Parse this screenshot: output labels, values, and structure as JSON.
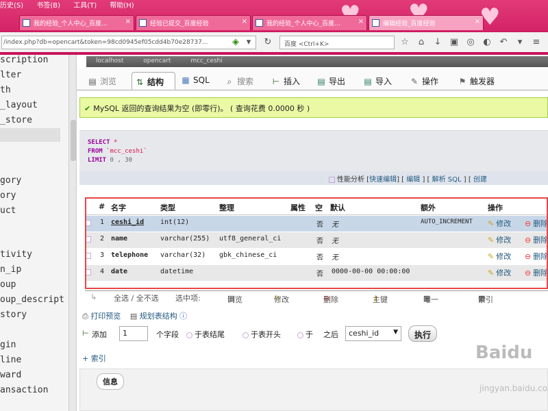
{
  "browser": {
    "menu": [
      "历史(S)",
      "书签(B)",
      "工具(T)",
      "帮助(H)"
    ],
    "tabs": [
      {
        "label": "我的经验_个人中心_百度..."
      },
      {
        "label": "经验已提交_百度经验"
      },
      {
        "label": "我的经验_个人中心_百度..."
      },
      {
        "label": "编辑经验_百度经验"
      }
    ],
    "url": "/index.php?db=opencart&token=98cd0945ef05cdd4b70e28737...",
    "search_placeholder": "百度 <Ctrl+K>"
  },
  "left_panel": {
    "items": [
      "scription",
      "lter",
      "th",
      "_layout",
      "_store",
      "gory",
      "ory",
      "uct",
      "tivity",
      "n_ip",
      "oup",
      "oup_descript",
      "story",
      "gin",
      "line",
      "ward",
      "ansaction"
    ]
  },
  "main": {
    "breadcrumb": [
      "localhost",
      "opencart",
      "mcc_ceshi"
    ],
    "tabs": [
      {
        "label": "浏览",
        "icon": "browse-icon"
      },
      {
        "label": "结构",
        "icon": "structure-icon"
      },
      {
        "label": "SQL",
        "icon": "sql-icon"
      },
      {
        "label": "搜索",
        "icon": "search-icon"
      },
      {
        "label": "插入",
        "icon": "insert-icon"
      },
      {
        "label": "导出",
        "icon": "export-icon"
      },
      {
        "label": "导入",
        "icon": "import-icon"
      },
      {
        "label": "操作",
        "icon": "operations-icon"
      },
      {
        "label": "触发器",
        "icon": "triggers-icon"
      }
    ],
    "success_message": "MySQL 返回的查询结果为空 (即零行)。 ( 查询花费 0.0000 秒 )",
    "sql": {
      "select": "SELECT",
      "select_arg": "*",
      "from": "FROM",
      "from_arg": "`mcc_ceshi`",
      "limit": "LIMIT",
      "limit_arg": "0 , 30"
    },
    "sql_links": {
      "profile": "性能分析",
      "inline_edit": "快速编辑",
      "edit": "编辑",
      "explain": "解析 SQL",
      "create": "创建"
    },
    "table": {
      "headers": [
        "#",
        "名字",
        "类型",
        "整理",
        "属性",
        "空",
        "默认",
        "额外",
        "操作"
      ],
      "rows": [
        {
          "num": "1",
          "name": "ceshi_id",
          "type": "int(12)",
          "collation": "",
          "null": "否",
          "default": "无",
          "extra": "AUTO_INCREMENT",
          "edit": "修改",
          "delete": "删除"
        },
        {
          "num": "2",
          "name": "name",
          "type": "varchar(255)",
          "collation": "utf8_general_ci",
          "null": "否",
          "default": "无",
          "extra": "",
          "edit": "修改",
          "delete": "删除"
        },
        {
          "num": "3",
          "name": "telephone",
          "type": "varchar(32)",
          "collation": "gbk_chinese_ci",
          "null": "否",
          "default": "无",
          "extra": "",
          "edit": "修改",
          "delete": "删除"
        },
        {
          "num": "4",
          "name": "date",
          "type": "datetime",
          "collation": "",
          "null": "否",
          "default": "0000-00-00 00:00:00",
          "extra": "",
          "edit": "修改",
          "delete": "删除"
        }
      ]
    },
    "bulk": [
      "全选 / 全不选",
      "选中项:",
      "浏览",
      "修改",
      "删除",
      "主键",
      "唯一",
      "索引"
    ],
    "print_view": "打印预览",
    "propose_structure": "规划表结构",
    "add": {
      "add_label": "添加",
      "count": "1",
      "field_label": "个字段",
      "end": "于表结尾",
      "begin": "于表开头",
      "after": "于",
      "after_label": "之后",
      "after_select": "ceshi_id",
      "go": "执行"
    },
    "index_link": "索引",
    "info_label": "信息"
  },
  "watermark": {
    "brand": "Baidu",
    "sub": "jingyan.baidu.com"
  }
}
